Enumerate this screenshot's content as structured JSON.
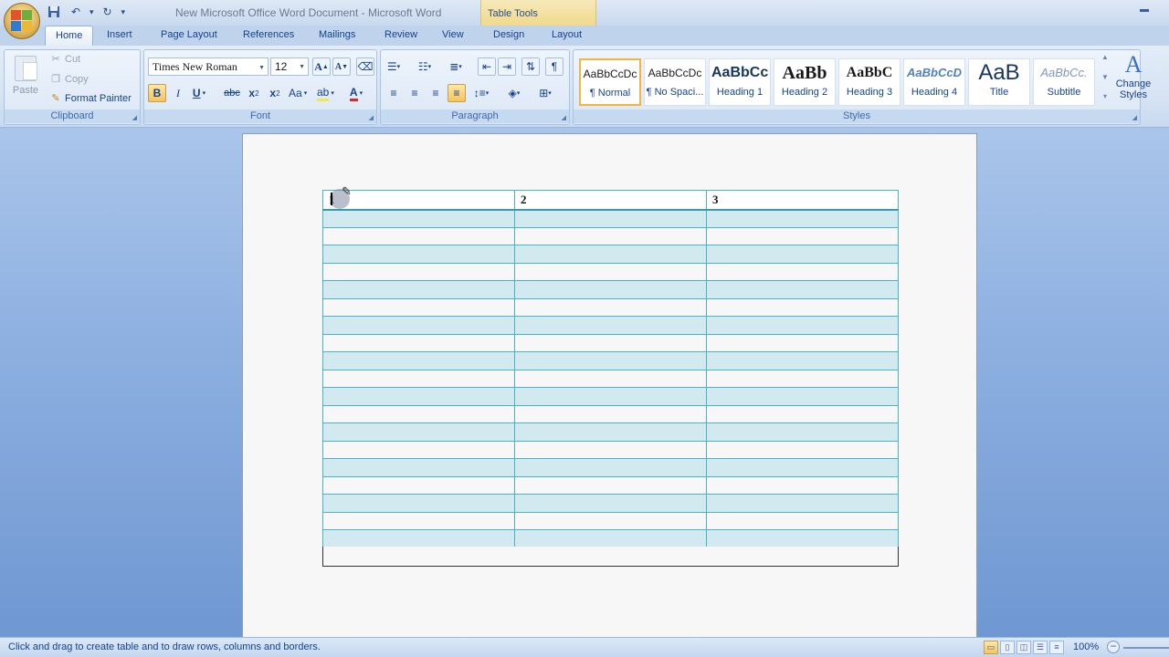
{
  "window": {
    "title": "New Microsoft Office Word Document - Microsoft Word",
    "contextual_tab_group": "Table Tools"
  },
  "tabs": [
    {
      "label": "Home",
      "active": true
    },
    {
      "label": "Insert"
    },
    {
      "label": "Page Layout"
    },
    {
      "label": "References"
    },
    {
      "label": "Mailings"
    },
    {
      "label": "Review"
    },
    {
      "label": "View"
    },
    {
      "label": "Design"
    },
    {
      "label": "Layout"
    }
  ],
  "clipboard": {
    "label": "Clipboard",
    "paste": "Paste",
    "cut": "Cut",
    "copy": "Copy",
    "format_painter": "Format Painter"
  },
  "font": {
    "label": "Font",
    "name": "Times New Roman",
    "size": "12"
  },
  "paragraph": {
    "label": "Paragraph"
  },
  "styles": {
    "label": "Styles",
    "items": [
      {
        "sample": "AaBbCcDc",
        "name": "¶ Normal",
        "selected": true
      },
      {
        "sample": "AaBbCcDc",
        "name": "¶ No Spaci..."
      },
      {
        "sample": "AaBbCc",
        "name": "Heading 1"
      },
      {
        "sample": "AaBb",
        "name": "Heading 2"
      },
      {
        "sample": "AaBbC",
        "name": "Heading 3"
      },
      {
        "sample": "AaBbCcD",
        "name": "Heading 4"
      },
      {
        "sample": "AaB",
        "name": "Title"
      },
      {
        "sample": "AaBbCc.",
        "name": "Subtitle"
      }
    ],
    "change_styles": "Change Styles"
  },
  "document": {
    "table": {
      "header": [
        "1",
        "2",
        "3"
      ],
      "body_row_count": 19
    }
  },
  "status": {
    "message": "Click and drag to create table and to draw rows, columns and borders.",
    "zoom": "100%"
  },
  "colors": {
    "table_border": "#47b5c9",
    "band_fill": "#d3e9f0",
    "ribbon_text": "#15428b"
  }
}
